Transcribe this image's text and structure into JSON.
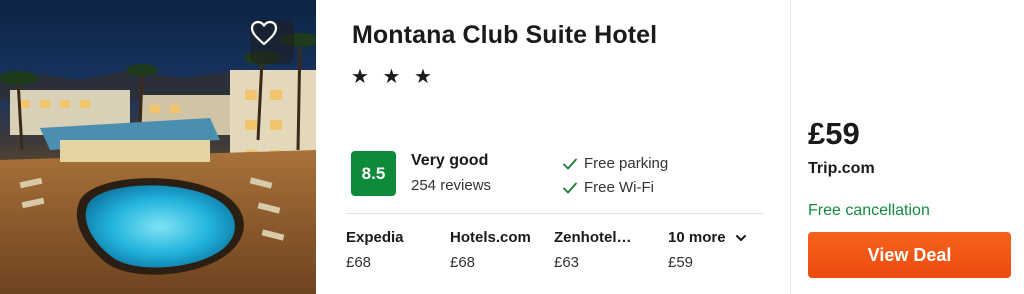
{
  "hotel": {
    "name": "Montana Club Suite Hotel",
    "stars": "★ ★ ★",
    "rating": {
      "score": "8.5",
      "label": "Very good",
      "reviews": "254 reviews"
    },
    "amenities": [
      "Free parking",
      "Free Wi-Fi"
    ],
    "offers": [
      {
        "provider": "Expedia",
        "price": "£68"
      },
      {
        "provider": "Hotels.com",
        "price": "£68"
      },
      {
        "provider": "Zenhotel…",
        "price": "£63"
      }
    ],
    "more_offers": {
      "label": "10 more",
      "price": "£59"
    }
  },
  "deal": {
    "price": "£59",
    "provider": "Trip.com",
    "cancellation": "Free cancellation",
    "button_label": "View Deal"
  },
  "icons": {
    "favorite": "heart-icon",
    "amenity": "check-icon",
    "expand": "chevron-down-icon"
  },
  "colors": {
    "rating_badge": "#0e8a3b",
    "free_cancellation": "#128a3e",
    "deal_button": "#f05a14",
    "amenity_check": "#1a7f37"
  }
}
